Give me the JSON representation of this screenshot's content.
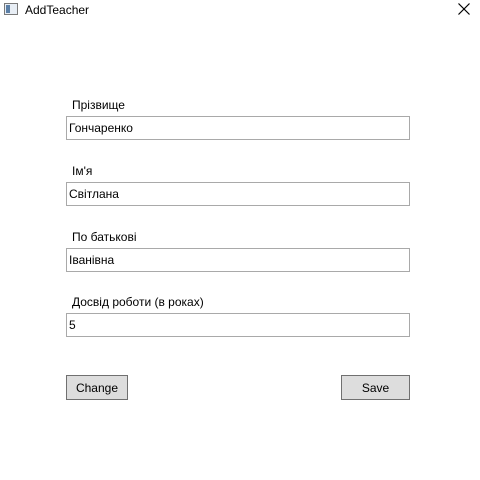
{
  "window": {
    "title": "AddTeacher",
    "app_icon": "window-app-icon",
    "close_icon": "close-x-icon"
  },
  "form": {
    "surname": {
      "label": "Прізвище",
      "value": "Гончаренко"
    },
    "name": {
      "label": "Ім'я",
      "value": "Світлана"
    },
    "patronymic": {
      "label": "По батькові",
      "value": "Іванівна"
    },
    "experience": {
      "label": "Досвід роботи (в роках)",
      "value": "5"
    }
  },
  "buttons": {
    "change_label": "Change",
    "save_label": "Save"
  },
  "colors": {
    "button_face": "#dddddd",
    "button_border": "#707070",
    "field_border": "#a9a9a9"
  }
}
